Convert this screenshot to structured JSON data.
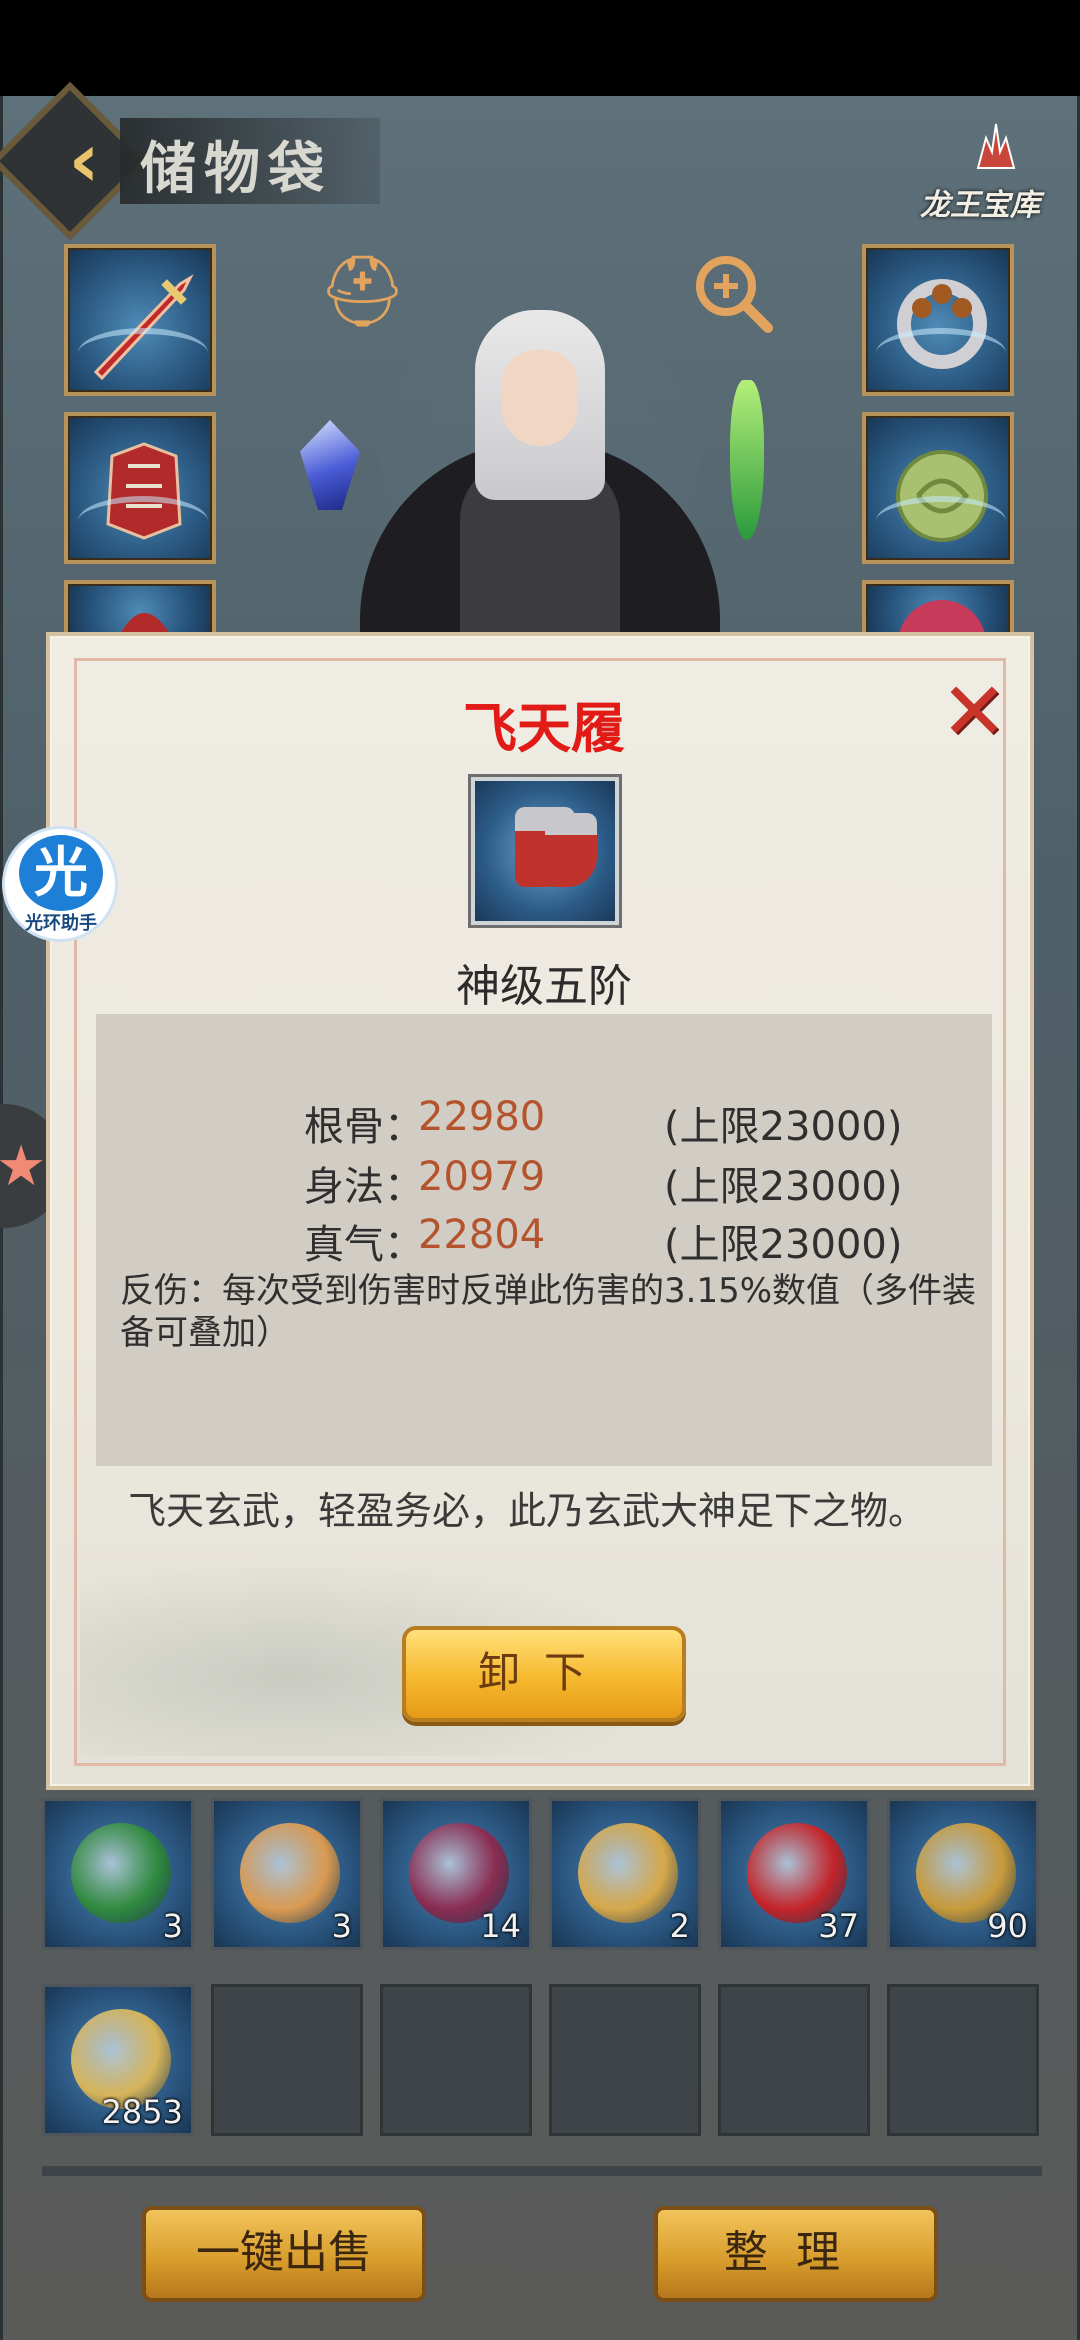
{
  "header": {
    "title": "储物袋",
    "treasury_label": "龙王宝库"
  },
  "popup": {
    "title": "飞天履",
    "grade": "神级五阶",
    "stats": [
      {
        "label": "根骨：",
        "value": "22980",
        "cap": "(上限23000)"
      },
      {
        "label": "身法：",
        "value": "20979",
        "cap": "(上限23000)"
      },
      {
        "label": "真气：",
        "value": "22804",
        "cap": "(上限23000)"
      }
    ],
    "effect": "反伤：每次受到伤害时反弹此伤害的3.15%数值（多件装备可叠加）",
    "flavor": "飞天玄武，轻盈务必，此乃玄武大神足下之物。",
    "unequip_label": "卸下",
    "close_icon": "close-icon"
  },
  "assistant": {
    "glyph": "光",
    "label": "光环助手"
  },
  "inventory": {
    "row1": [
      {
        "count": "3",
        "color": "#2f8a3e"
      },
      {
        "count": "3",
        "color": "#d99a52"
      },
      {
        "count": "14",
        "color": "#8a2c52"
      },
      {
        "count": "2",
        "color": "#d6a84a"
      },
      {
        "count": "37",
        "color": "#c4242a"
      },
      {
        "count": "90",
        "color": "#c89a3a"
      }
    ],
    "row2": [
      {
        "count": "2853",
        "color": "#d6b45a"
      }
    ]
  },
  "footer": {
    "sell_all_label": "一键出售",
    "sort_label": "整理"
  },
  "colors": {
    "title_red": "#e21b16",
    "stat_value": "#b4532c",
    "gold_button": "#f6b82e"
  }
}
